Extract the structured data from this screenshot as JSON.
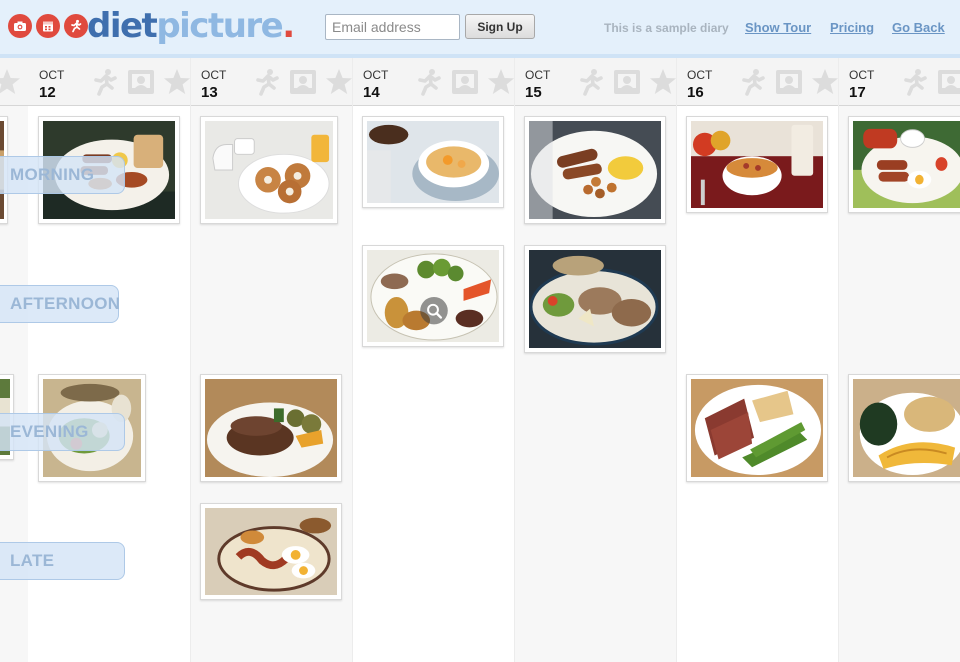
{
  "header": {
    "logo": {
      "part1": "diet",
      "part2": "picture",
      "part3": "."
    },
    "logo_icons": [
      "camera-icon",
      "calendar-icon",
      "runner-icon"
    ],
    "email": {
      "placeholder": "Email address",
      "value": ""
    },
    "signup_label": "Sign Up",
    "sample_note": "This is a sample diary",
    "nav": [
      "Show Tour",
      "Pricing",
      "Go Back"
    ]
  },
  "days": [
    {
      "month": "OCT",
      "day": "12"
    },
    {
      "month": "OCT",
      "day": "13"
    },
    {
      "month": "OCT",
      "day": "14"
    },
    {
      "month": "OCT",
      "day": "15"
    },
    {
      "month": "OCT",
      "day": "16"
    },
    {
      "month": "OCT",
      "day": "17"
    }
  ],
  "day_icons": [
    "runner-icon",
    "photo-icon",
    "star-icon"
  ],
  "meals": [
    "MORNING",
    "AFTERNOON",
    "EVENING",
    "LATE"
  ],
  "meal_photos": [
    {
      "day": "12",
      "meal": "MORNING",
      "subject": "full-breakfast-photo"
    },
    {
      "day": "12",
      "meal": "EVENING",
      "subject": "salad-plate-photo"
    },
    {
      "day": "13",
      "meal": "MORNING",
      "subject": "bagel-breakfast-photo"
    },
    {
      "day": "13",
      "meal": "EVENING",
      "subject": "roast-beef-dinner-photo"
    },
    {
      "day": "13",
      "meal": "LATE",
      "subject": "eggs-bacon-photo"
    },
    {
      "day": "14",
      "meal": "MORNING",
      "subject": "oatmeal-coffee-photo"
    },
    {
      "day": "14",
      "meal": "AFTERNOON",
      "subject": "roast-vegetables-photo"
    },
    {
      "day": "15",
      "meal": "MORNING",
      "subject": "sausage-potatoes-photo"
    },
    {
      "day": "15",
      "meal": "AFTERNOON",
      "subject": "salad-platter-photo"
    },
    {
      "day": "16",
      "meal": "MORNING",
      "subject": "cereal-milk-photo"
    },
    {
      "day": "16",
      "meal": "EVENING",
      "subject": "steak-peas-photo"
    },
    {
      "day": "17",
      "meal": "MORNING",
      "subject": "english-breakfast-photo"
    },
    {
      "day": "17",
      "meal": "EVENING",
      "subject": "chicken-spinach-photo"
    }
  ],
  "colors": {
    "brand_red": "#e04a3e",
    "brand_blue": "#3f6fae",
    "brand_light_blue": "#8fb8e2",
    "header_bg": "#e4f0fb",
    "link": "#6a95c4"
  }
}
